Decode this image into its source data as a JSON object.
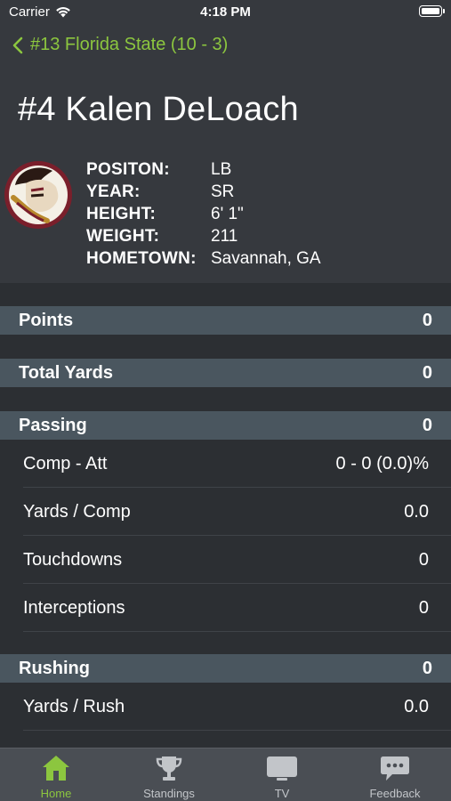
{
  "status_bar": {
    "carrier": "Carrier",
    "time": "4:18 PM"
  },
  "navigation": {
    "back_label": "#13 Florida State (10 - 3)"
  },
  "player": {
    "title": "#4 Kalen DeLoach",
    "info": [
      {
        "label": "POSITON:",
        "value": "LB"
      },
      {
        "label": "YEAR:",
        "value": "SR"
      },
      {
        "label": "HEIGHT:",
        "value": "6' 1\""
      },
      {
        "label": "WEIGHT:",
        "value": "211"
      },
      {
        "label": "HOMETOWN:",
        "value": "Savannah, GA"
      }
    ]
  },
  "stats": {
    "points": {
      "label": "Points",
      "value": "0"
    },
    "total_yards": {
      "label": "Total Yards",
      "value": "0"
    },
    "passing": {
      "label": "Passing",
      "value": "0",
      "rows": [
        {
          "label": "Comp - Att",
          "value": "0 - 0 (0.0)%"
        },
        {
          "label": "Yards / Comp",
          "value": "0.0"
        },
        {
          "label": "Touchdowns",
          "value": "0"
        },
        {
          "label": "Interceptions",
          "value": "0"
        }
      ]
    },
    "rushing": {
      "label": "Rushing",
      "value": "0",
      "rows": [
        {
          "label": "Yards / Rush",
          "value": "0.0"
        }
      ]
    }
  },
  "tab_bar": {
    "active": "Home",
    "tabs": [
      {
        "label": "Home",
        "icon": "home-icon"
      },
      {
        "label": "Standings",
        "icon": "trophy-icon"
      },
      {
        "label": "TV",
        "icon": "tv-icon"
      },
      {
        "label": "Feedback",
        "icon": "feedback-icon"
      }
    ]
  },
  "colors": {
    "accent": "#8cc63f",
    "section_header": "#4a565f",
    "background": "#2c2f33",
    "header_background": "#36393e",
    "tab_bar": "#4a4e54"
  }
}
